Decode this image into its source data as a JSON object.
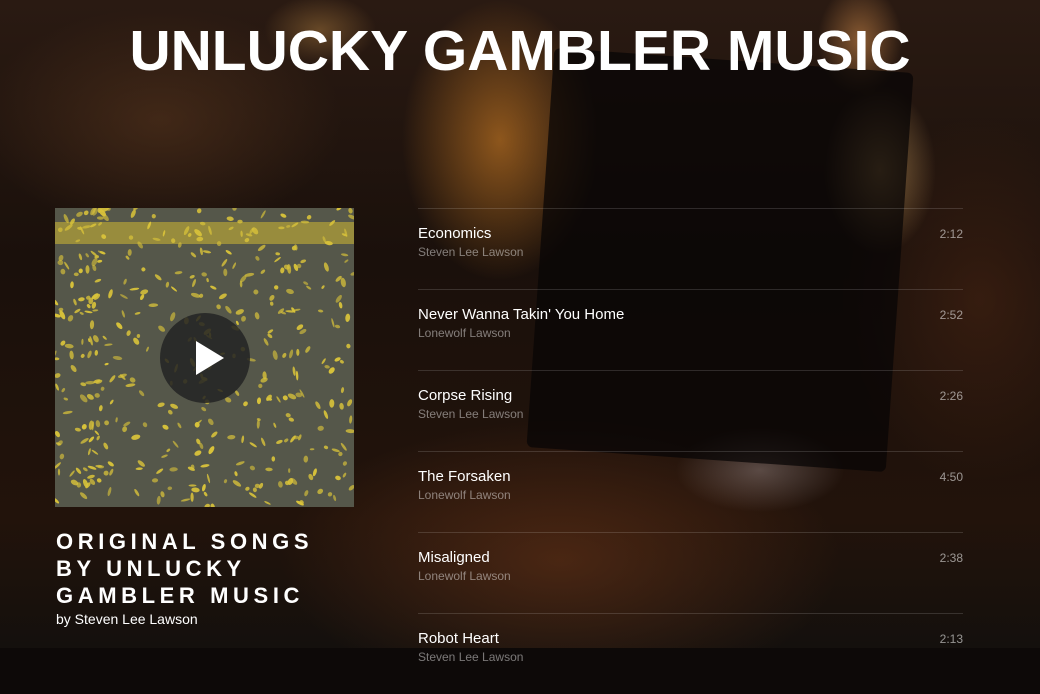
{
  "site": {
    "title": "UNLUCKY GAMBLER MUSIC"
  },
  "album": {
    "title": "ORIGINAL SONGS\nBY UNLUCKY\nGAMBLER MUSIC",
    "byline": "by Steven Lee Lawson",
    "play_icon": "play-icon"
  },
  "tracks": [
    {
      "title": "Economics",
      "artist": "Steven Lee Lawson",
      "duration": "2:12"
    },
    {
      "title": "Never Wanna Takin' You Home",
      "artist": "Lonewolf Lawson",
      "duration": "2:52"
    },
    {
      "title": "Corpse Rising",
      "artist": "Steven Lee Lawson",
      "duration": "2:26"
    },
    {
      "title": "The Forsaken",
      "artist": "Lonewolf Lawson",
      "duration": "4:50"
    },
    {
      "title": "Misaligned",
      "artist": "Lonewolf Lawson",
      "duration": "2:38"
    },
    {
      "title": "Robot Heart",
      "artist": "Steven Lee Lawson",
      "duration": "2:13"
    }
  ],
  "colors": {
    "text": "#ffffff",
    "muted": "#8c8580",
    "divider": "#3a3230"
  }
}
